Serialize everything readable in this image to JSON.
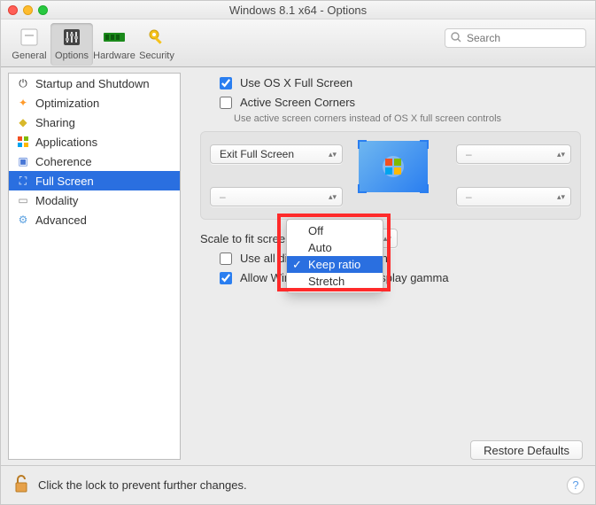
{
  "title": "Windows 8.1 x64 - Options",
  "toolbar": [
    {
      "id": "general",
      "label": "General"
    },
    {
      "id": "options",
      "label": "Options"
    },
    {
      "id": "hardware",
      "label": "Hardware"
    },
    {
      "id": "security",
      "label": "Security"
    }
  ],
  "toolbar_active": "options",
  "search": {
    "placeholder": "Search"
  },
  "sidebar": [
    {
      "id": "startup",
      "label": "Startup and Shutdown"
    },
    {
      "id": "optimization",
      "label": "Optimization"
    },
    {
      "id": "sharing",
      "label": "Sharing"
    },
    {
      "id": "applications",
      "label": "Applications"
    },
    {
      "id": "coherence",
      "label": "Coherence"
    },
    {
      "id": "fullscreen",
      "label": "Full Screen"
    },
    {
      "id": "modality",
      "label": "Modality"
    },
    {
      "id": "advanced",
      "label": "Advanced"
    }
  ],
  "sidebar_selected": "fullscreen",
  "options": {
    "use_osx_full_screen": {
      "label": "Use OS X Full Screen",
      "checked": true
    },
    "active_screen_corners": {
      "label": "Active Screen Corners",
      "checked": false,
      "hint": "Use active screen corners instead of OS X full screen controls"
    },
    "corners": {
      "tl": "Exit Full Screen",
      "tr": "–",
      "bl": "–",
      "br": "–"
    },
    "scale_label": "Scale to fit screen:",
    "scale_value": "Keep ratio",
    "scale_options": [
      "Off",
      "Auto",
      "Keep ratio",
      "Stretch"
    ],
    "use_all_displays": {
      "label": "Use all displays in full screen",
      "checked": false
    },
    "allow_gamma": {
      "label": "Allow Windows 8.1 to set display gamma",
      "checked": true
    }
  },
  "buttons": {
    "restore": "Restore Defaults"
  },
  "footer": {
    "lock_text": "Click the lock to prevent further changes."
  }
}
